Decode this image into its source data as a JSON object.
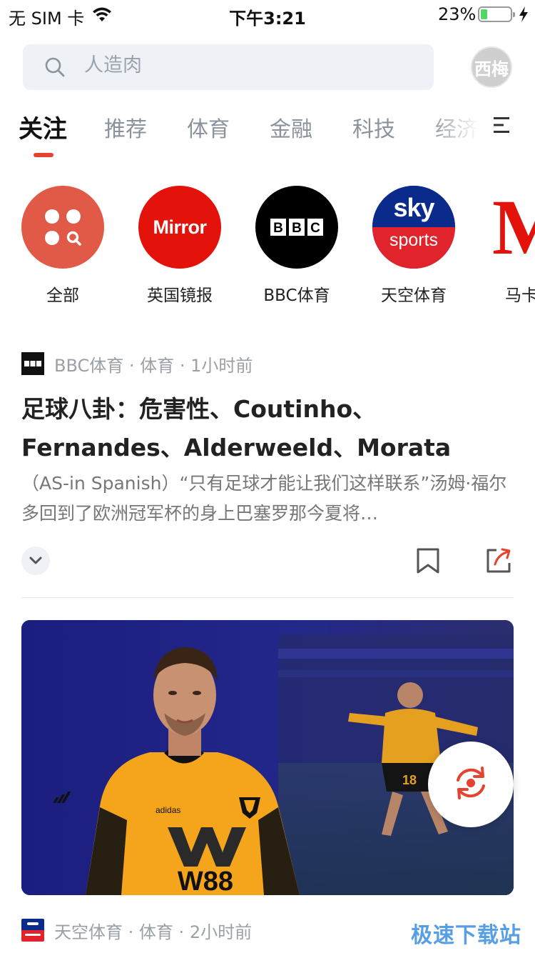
{
  "status_bar": {
    "carrier": "无 SIM 卡",
    "time": "下午3:21",
    "battery": "23%",
    "battery_level": 0.23
  },
  "search": {
    "placeholder": "人造肉"
  },
  "avatar": {
    "label": "西梅"
  },
  "tabs": [
    {
      "label": "关注",
      "active": true
    },
    {
      "label": "推荐"
    },
    {
      "label": "体育"
    },
    {
      "label": "金融"
    },
    {
      "label": "科技"
    },
    {
      "label": "经济"
    }
  ],
  "sources": [
    {
      "name": "全部",
      "icon": "all-sources-icon",
      "color": "#e05a47"
    },
    {
      "name": "英国镜报",
      "logo_text": "Mirror",
      "color": "#e3120b"
    },
    {
      "name": "BBC体育",
      "logo_text": "BBC",
      "color": "#000000"
    },
    {
      "name": "天空体育",
      "logo_top": "sky",
      "logo_bottom": "sports",
      "color_top": "#0a2a8c",
      "color_bottom": "#e1242b"
    },
    {
      "name": "马卡",
      "logo_text": "M",
      "color": "#e3120b"
    }
  ],
  "articles": [
    {
      "source": "BBC体育",
      "category": "体育",
      "time": "1小时前",
      "title": "足球八卦：危害性、Coutinho、Fernandes、Alderweeld、Morata",
      "excerpt": "（AS-in Spanish）“只有足球才能让我们这样联系”汤姆·福尔多回到了欧洲冠军杯的身上巴塞罗那今夏将…"
    },
    {
      "source": "天空体育",
      "category": "体育",
      "time": "2小时前",
      "image": {
        "shirt_sponsor": "W88",
        "kit_brand": "adidas",
        "player_number": "18"
      }
    }
  ],
  "watermark": "极速下载站",
  "colors": {
    "accent": "#e5422f",
    "tab_inactive": "#8a939c",
    "meta_gray": "#9aa0a6"
  }
}
